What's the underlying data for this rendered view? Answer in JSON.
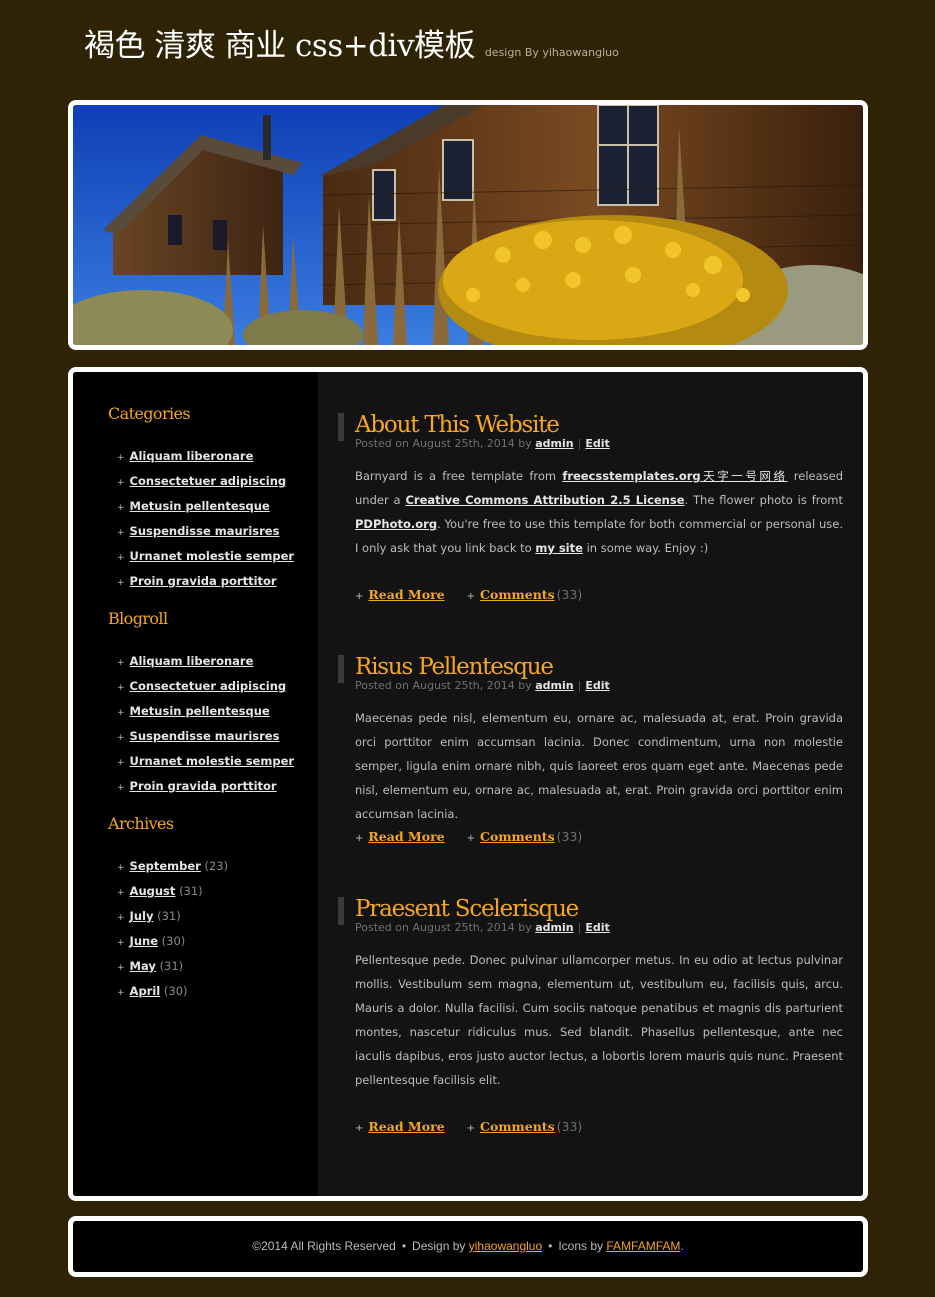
{
  "header": {
    "title": "褐色 清爽 商业 css+div模板",
    "slogan": "design By yihaowangluo"
  },
  "sidebar": {
    "categories": {
      "heading": "Categories",
      "items": [
        "Aliquam liberonare",
        "Consectetuer adipiscing",
        "Metusin pellentesque",
        "Suspendisse maurisres",
        "Urnanet molestie semper",
        "Proin gravida porttitor"
      ]
    },
    "blogroll": {
      "heading": "Blogroll",
      "items": [
        "Aliquam liberonare",
        "Consectetuer adipiscing",
        "Metusin pellentesque",
        "Suspendisse maurisres",
        "Urnanet molestie semper",
        "Proin gravida porttitor"
      ]
    },
    "archives": {
      "heading": "Archives",
      "items": [
        {
          "label": "September",
          "count": "(23)"
        },
        {
          "label": "August",
          "count": "(31)"
        },
        {
          "label": "July",
          "count": "(31)"
        },
        {
          "label": "June",
          "count": "(30)"
        },
        {
          "label": "May",
          "count": "(31)"
        },
        {
          "label": "April",
          "count": "(30)"
        }
      ]
    }
  },
  "posts": [
    {
      "title": "About This Website",
      "meta_prefix": "Posted on August 25th, 2014 by",
      "author": "admin",
      "edit": "Edit",
      "body": {
        "t1": "Barnyard is a free template from ",
        "l1": "freecsstemplates.org",
        "l2": "天字一号网络",
        "t2": " released under a ",
        "l3": "Creative Commons Attribution 2.5 License",
        "t3": ". The flower photo is fromt ",
        "l4": "PDPhoto.org",
        "t4": ". You're free to use this template for both commercial or personal use. I only ask that you link back to ",
        "l5": "my site",
        "t5": " in some way. Enjoy :)"
      },
      "read_more": "Read More",
      "comments": "Comments",
      "comment_count": "(33)"
    },
    {
      "title": "Risus Pellentesque",
      "meta_prefix": "Posted on August 25th, 2014 by",
      "author": "admin",
      "edit": "Edit",
      "body": "Maecenas pede nisl, elementum eu, ornare ac, malesuada at, erat. Proin gravida orci porttitor enim accumsan lacinia. Donec condimentum, urna non molestie semper, ligula enim ornare nibh, quis laoreet eros quam eget ante. Maecenas pede nisl, elementum eu, ornare ac, malesuada at, erat. Proin gravida orci porttitor enim accumsan lacinia.",
      "read_more": "Read More",
      "comments": "Comments",
      "comment_count": "(33)"
    },
    {
      "title": "Praesent Scelerisque",
      "meta_prefix": "Posted on August 25th, 2014 by",
      "author": "admin",
      "edit": "Edit",
      "body": "Pellentesque pede. Donec pulvinar ullamcorper metus. In eu odio at lectus pulvinar mollis. Vestibulum sem magna, elementum ut, vestibulum eu, facilisis quis, arcu. Mauris a dolor. Nulla facilisi. Cum sociis natoque penatibus et magnis dis parturient montes, nascetur ridiculus mus. Sed blandit. Phasellus pellentesque, ante nec iaculis dapibus, eros justo auctor lectus, a lobortis lorem mauris quis nunc. Praesent pellentesque facilisis elit.",
      "read_more": "Read More",
      "comments": "Comments",
      "comment_count": "(33)"
    }
  ],
  "footer": {
    "copyright": "©2014 All Rights Reserved",
    "design_prefix": "Design by",
    "design_link": "yihaowangluo",
    "icons_prefix": "Icons by",
    "icons_link": "FAMFAMFAM",
    "dot": "•",
    "end": "."
  },
  "colors": {
    "page_bg": "#2f2305",
    "accent": "#f5a623",
    "content_bg": "#131313",
    "sidebar_bg": "#000000"
  }
}
